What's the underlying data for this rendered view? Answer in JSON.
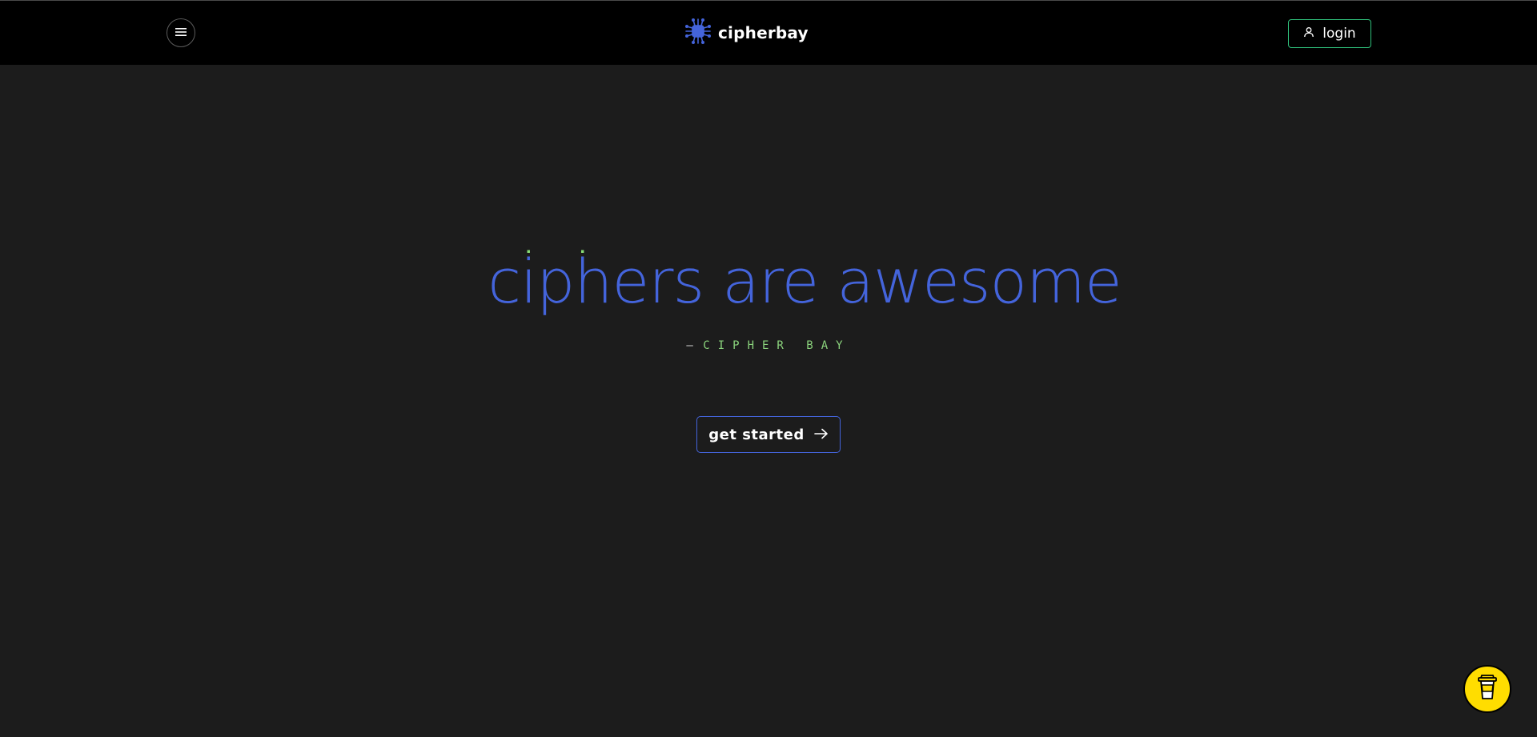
{
  "navbar": {
    "brand_name": "cipherbay",
    "login_label": "login"
  },
  "hero": {
    "title": "ciphers are awesome",
    "tagline": "CIPHER BAY",
    "cta_label": "get started"
  },
  "icons": {
    "menu": "hamburger-icon",
    "logo": "chip-icon",
    "login": "user-icon",
    "cta": "arrow-right-icon",
    "coffee": "coffee-cup-icon"
  },
  "colors": {
    "page_bg": "#1c1c1c",
    "navbar_bg": "#000000",
    "title_blue": "#4464db",
    "accent_green": "#8ee87a",
    "login_border": "#2fbf7a",
    "coffee_yellow": "#ffdd00"
  }
}
